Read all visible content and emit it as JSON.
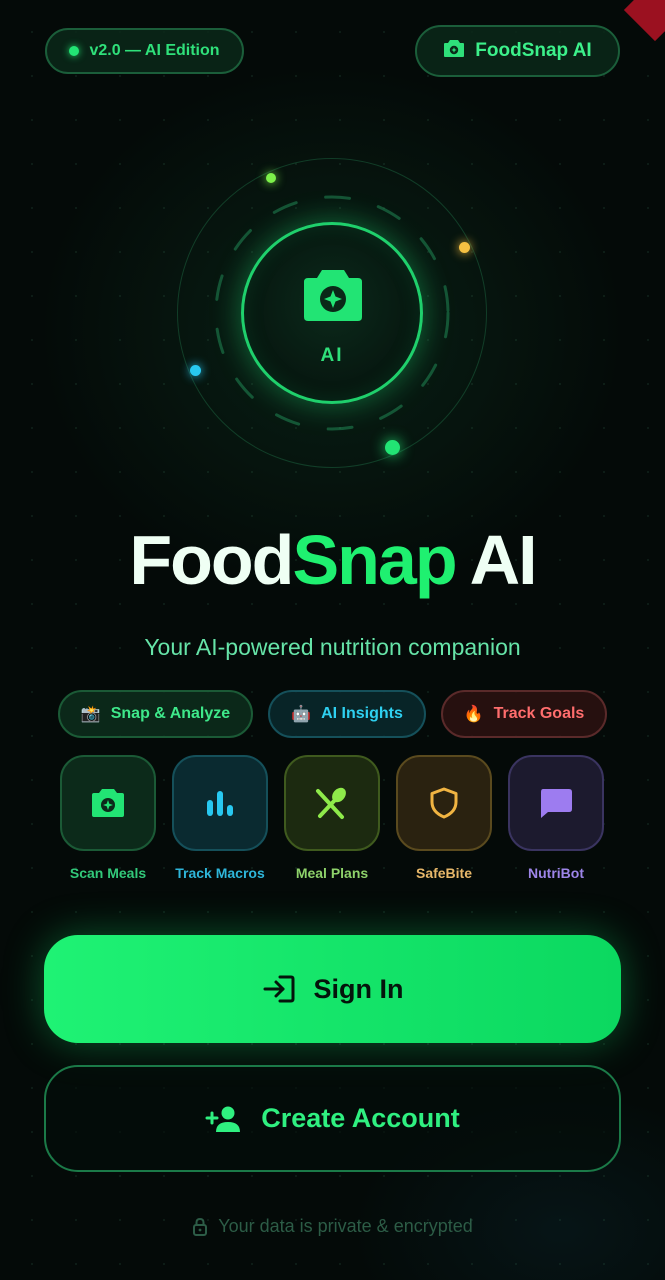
{
  "header": {
    "version_label": "v2.0 — AI Edition",
    "brand_label": "FoodSnap AI"
  },
  "hero": {
    "core_label": "AI"
  },
  "title": {
    "part1": "Food",
    "part2": "Snap",
    "part3": "AI"
  },
  "subtitle": "Your AI-powered nutrition companion",
  "chips": [
    {
      "emoji": "📸",
      "label": "Snap & Analyze"
    },
    {
      "emoji": "🤖",
      "label": "AI Insights"
    },
    {
      "emoji": "🔥",
      "label": "Track Goals"
    }
  ],
  "features": [
    {
      "label": "Scan Meals",
      "icon": "camera-icon"
    },
    {
      "label": "Track Macros",
      "icon": "bar-chart-icon"
    },
    {
      "label": "Meal Plans",
      "icon": "utensils-icon"
    },
    {
      "label": "SafeBite",
      "icon": "shield-icon"
    },
    {
      "label": "NutriBot",
      "icon": "chat-icon"
    }
  ],
  "actions": {
    "sign_in": "Sign In",
    "create_account": "Create Account"
  },
  "footer": {
    "privacy": "Your data is private & encrypted"
  },
  "colors": {
    "accent": "#1ff070",
    "background": "#040a08"
  }
}
